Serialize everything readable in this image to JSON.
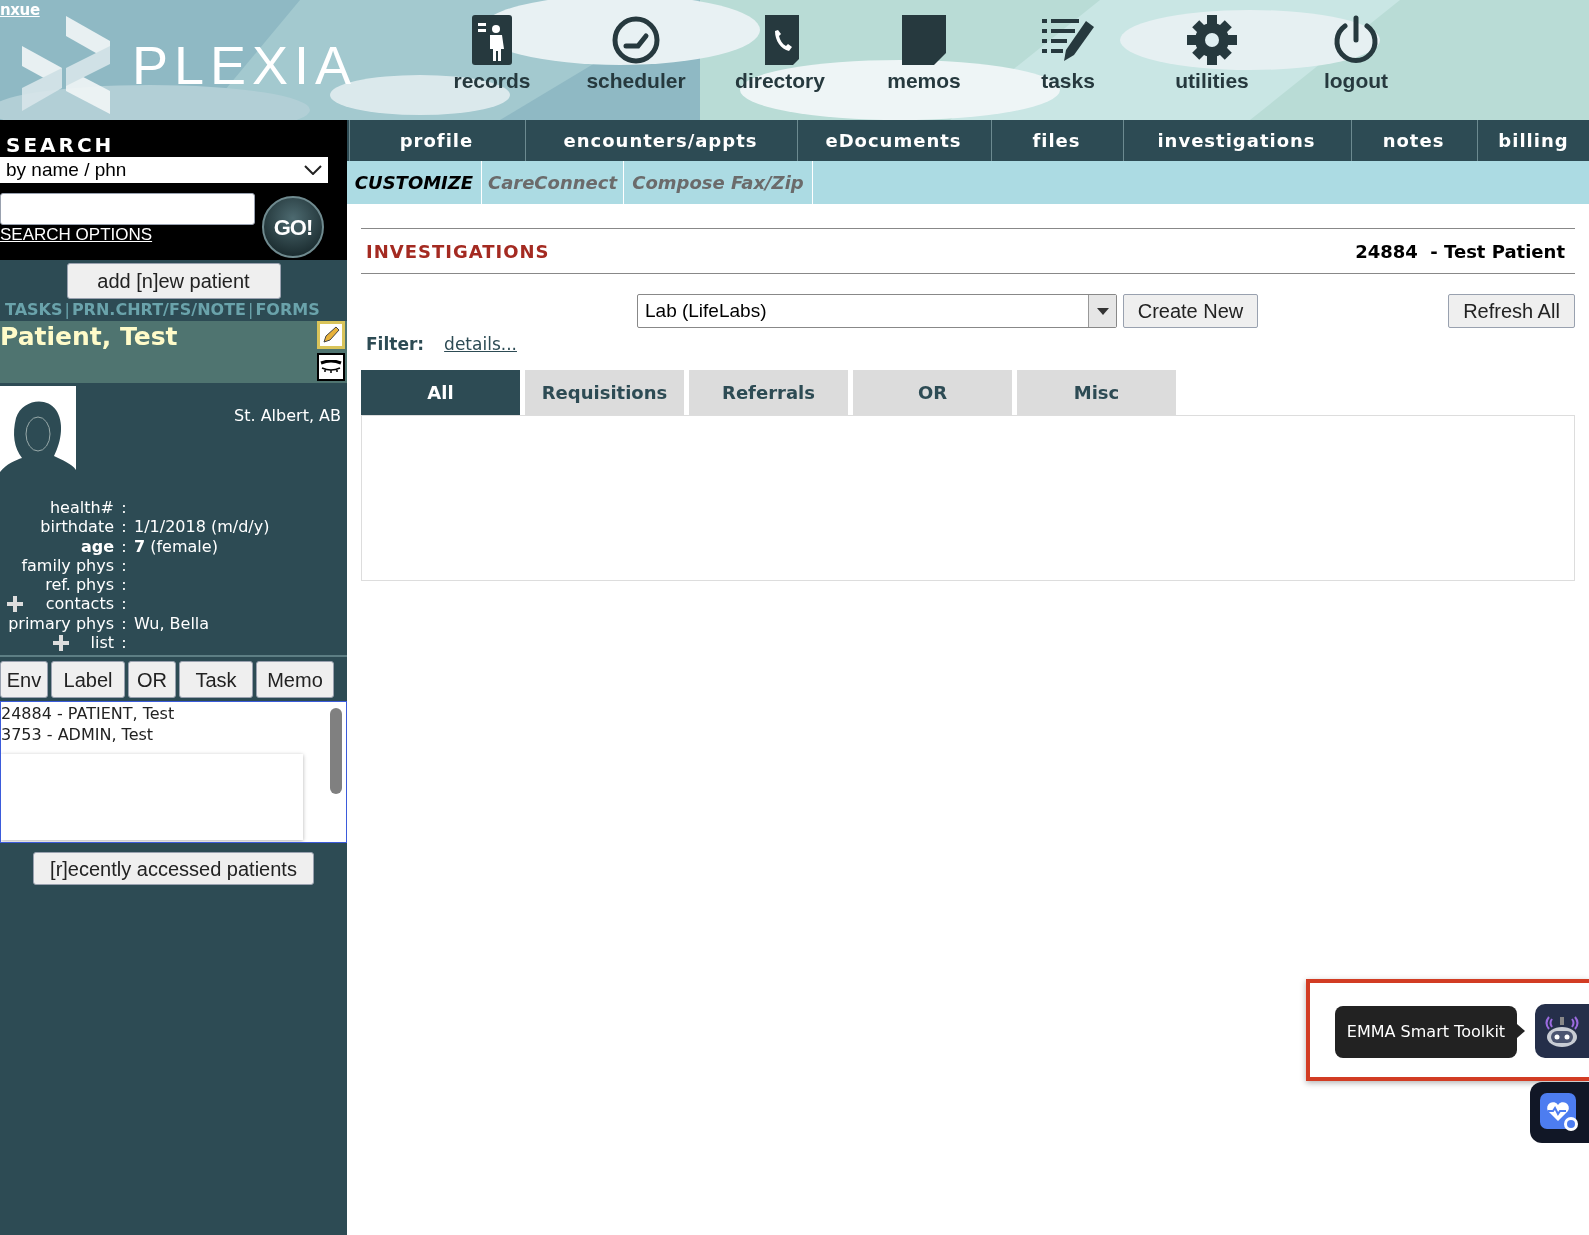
{
  "header": {
    "user_link": "nxue",
    "logo_text": "PLEXIA",
    "nav": [
      {
        "label": "records",
        "kind": "records"
      },
      {
        "label": "scheduler",
        "kind": "scheduler"
      },
      {
        "label": "directory",
        "kind": "directory"
      },
      {
        "label": "memos",
        "kind": "memos"
      },
      {
        "label": "tasks",
        "kind": "tasks"
      },
      {
        "label": "utilities",
        "kind": "utilities"
      },
      {
        "label": "logout",
        "kind": "logout"
      }
    ]
  },
  "search": {
    "title": "SEARCH",
    "mode": "by name / phn",
    "go": "GO!",
    "options_link": "SEARCH OPTIONS"
  },
  "add_patient": "add [n]ew patient",
  "quick_links": [
    {
      "label": "TASKS"
    },
    {
      "separator": "|",
      "label": "PRN.CHRT/FS/NOTE"
    },
    {
      "separator": "|",
      "label": "FORMS"
    }
  ],
  "patient": {
    "name": "Patient, Test",
    "location": "St. Albert, AB",
    "fields": [
      {
        "label": "health#",
        "colon": ":",
        "kind": "plain"
      },
      {
        "label": "birthdate",
        "colon": ":",
        "value": "1/1/2018 (m/d/y)",
        "kind": "plain"
      },
      {
        "label": "age",
        "colon": ":",
        "value": "**7** (female)",
        "kind": "bold"
      },
      {
        "label": "family phys",
        "colon": ":",
        "kind": "plain"
      },
      {
        "label": "ref. phys",
        "colon": ":",
        "kind": "plain"
      },
      {
        "label": "contacts",
        "colon": ":",
        "kind": "addable"
      },
      {
        "label": "primary phys",
        "colon": ":",
        "value": "Wu, Bella",
        "kind": "plain"
      },
      {
        "label": "list",
        "colon": ":",
        "kind": "addable"
      }
    ]
  },
  "action_buttons": [
    "Env",
    "Label",
    "OR",
    "Task",
    "Memo"
  ],
  "recent_list": [
    "24884 - PATIENT, Test",
    "3753 - ADMIN, Test"
  ],
  "recent_button": "[r]ecently accessed patients",
  "main_tabs": [
    "profile",
    "encounters/appts",
    "eDocuments",
    "files",
    "investigations",
    "notes",
    "billing"
  ],
  "sub_tabs": [
    {
      "label": "CUSTOMIZE",
      "selected": true
    },
    {
      "label": "CareConnect",
      "selected": false
    },
    {
      "label": "Compose Fax/Zip",
      "selected": false
    }
  ],
  "section": {
    "title": "INVESTIGATIONS",
    "patient_id": "24884  - Test Patient"
  },
  "lab_select": "Lab (LifeLabs)",
  "create_button": "Create New",
  "refresh_button": "Refresh All",
  "filter": {
    "label": "Filter:",
    "link": "details..."
  },
  "inv_tabs": [
    {
      "label": "All",
      "selected": true
    },
    {
      "label": "Requisitions",
      "selected": false
    },
    {
      "label": "Referrals",
      "selected": false
    },
    {
      "label": "OR",
      "selected": false
    },
    {
      "label": "Misc",
      "selected": false
    }
  ],
  "toolkit": {
    "tooltip": "EMMA Smart Toolkit",
    "highlighted": true
  }
}
